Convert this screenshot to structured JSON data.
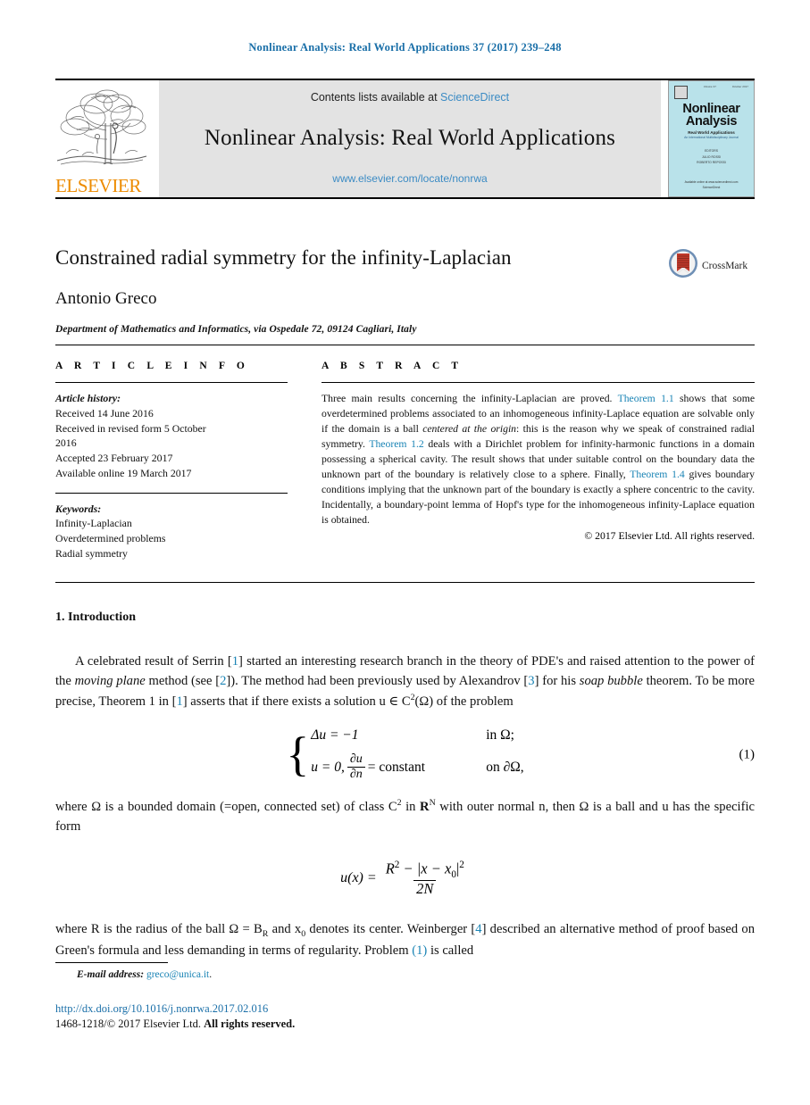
{
  "running_head": "Nonlinear Analysis: Real World Applications 37 (2017) 239–248",
  "masthead": {
    "publisher_wordmark": "ELSEVIER",
    "contents_prefix": "Contents lists available at",
    "contents_link": "ScienceDirect",
    "journal_title": "Nonlinear Analysis: Real World Applications",
    "journal_url": "www.elsevier.com/locate/nonrwa",
    "cover": {
      "title_line1": "Nonlinear",
      "title_line2": "Analysis",
      "subtitle": "Real World Applications",
      "subtitle2": "An International Multidisciplinary Journal",
      "editors_label": "EDITORS",
      "editor1": "JULIO ROSSI",
      "editor2": "ROBERTO REPOSSI",
      "footer_line1": "Available online at www.sciencedirect.com",
      "footer_line2": "ScienceDirect",
      "topbar_left": "ISSN 1468-1218",
      "topbar_mid": "Volume 37",
      "topbar_right": "October 2017"
    }
  },
  "article": {
    "title": "Constrained radial symmetry for the infinity-Laplacian",
    "author": "Antonio Greco",
    "affiliation": "Department of Mathematics and Informatics, via Ospedale 72, 09124 Cagliari, Italy",
    "crossmark_label": "CrossMark"
  },
  "info": {
    "section_label": "A R T I C L E   I N F O",
    "history_label": "Article history:",
    "history": [
      "Received 14 June 2016",
      "Received in revised form 5 October",
      "2016",
      "Accepted 23 February 2017",
      "Available online 19 March 2017"
    ],
    "keywords_label": "Keywords:",
    "keywords": [
      "Infinity-Laplacian",
      "Overdetermined problems",
      "Radial symmetry"
    ]
  },
  "abstract": {
    "section_label": "A B S T R A C T",
    "s1": "Three main results concerning the infinity-Laplacian are proved. ",
    "link1": "Theorem 1.1",
    "s2": " shows that some overdetermined problems associated to an inhomogeneous infinity-Laplace equation are solvable only if the domain is a ball ",
    "italic1": "centered at the origin",
    "s3": ": this is the reason why we speak of constrained radial symmetry. ",
    "link2": "Theorem 1.2",
    "s4": " deals with a Dirichlet problem for infinity-harmonic functions in a domain possessing a spherical cavity. The result shows that under suitable control on the boundary data the unknown part of the boundary is relatively close to a sphere. Finally, ",
    "link3": "Theorem 1.4",
    "s5": " gives boundary conditions implying that the unknown part of the boundary is exactly a sphere concentric to the cavity. Incidentally, a boundary-point lemma of Hopf's type for the inhomogeneous infinity-Laplace equation is obtained.",
    "copyright": "© 2017 Elsevier Ltd. All rights reserved."
  },
  "body": {
    "section_heading": "1. Introduction",
    "p1_a": "A celebrated result of Serrin [",
    "p1_ref1": "1",
    "p1_b": "] started an interesting research branch in the theory of PDE's and raised attention to the power of the ",
    "p1_it1": "moving plane",
    "p1_c": " method (see [",
    "p1_ref2": "2",
    "p1_d": "]). The method had been previously used by Alexandrov [",
    "p1_ref3": "3",
    "p1_e": "] for his ",
    "p1_it2": "soap bubble",
    "p1_f": " theorem. To be more precise, Theorem 1 in [",
    "p1_ref4": "1",
    "p1_g": "] asserts that if there exists a solution u ∈ C",
    "p1_sup": "2",
    "p1_h": "(Ω) of the problem",
    "eq1": {
      "line1_lhs": "Δu = −1",
      "line1_rhs": "in Ω;",
      "line2_lhs_a": "u = 0,",
      "line2_frac_num": "∂u",
      "line2_frac_den": "∂n",
      "line2_lhs_b": "= constant",
      "line2_rhs": "on ∂Ω,",
      "number": "(1)"
    },
    "p2_a": "where Ω is a bounded domain (=open, connected set) of class C",
    "p2_sup": "2",
    "p2_b": " in ",
    "p2_bold_R": "R",
    "p2_supN": "N",
    "p2_c": " with outer normal n, then Ω is a ball and u has the specific form",
    "eq2": {
      "lhs": "u(x) =",
      "num_a": "R",
      "num_sup": "2",
      "num_b": " − |x − x",
      "num_sub": "0",
      "num_c": "|",
      "num_sup2": "2",
      "den": "2N"
    },
    "p3_a": "where R is the radius of the ball Ω = B",
    "p3_sub": "R",
    "p3_b": " and x",
    "p3_sub2": "0",
    "p3_c": " denotes its center. Weinberger [",
    "p3_ref": "4",
    "p3_d": "] described an alternative method of proof based on Green's formula and less demanding in terms of regularity. Problem ",
    "p3_ref_eq": "(1)",
    "p3_e": " is called"
  },
  "footer": {
    "email_label": "E-mail address:",
    "email": "greco@unica.it",
    "email_period": ".",
    "doi": "http://dx.doi.org/10.1016/j.nonrwa.2017.02.016",
    "issn_a": "1468-1218/© 2017 Elsevier Ltd. ",
    "issn_b": "All rights reserved."
  },
  "colors": {
    "link_blue": "#1a84b5",
    "header_blue": "#1a6fa8",
    "elsevier_orange": "#ED8B00",
    "band_gray": "#e3e3e3",
    "cover_cyan": "#b9e2ea"
  }
}
